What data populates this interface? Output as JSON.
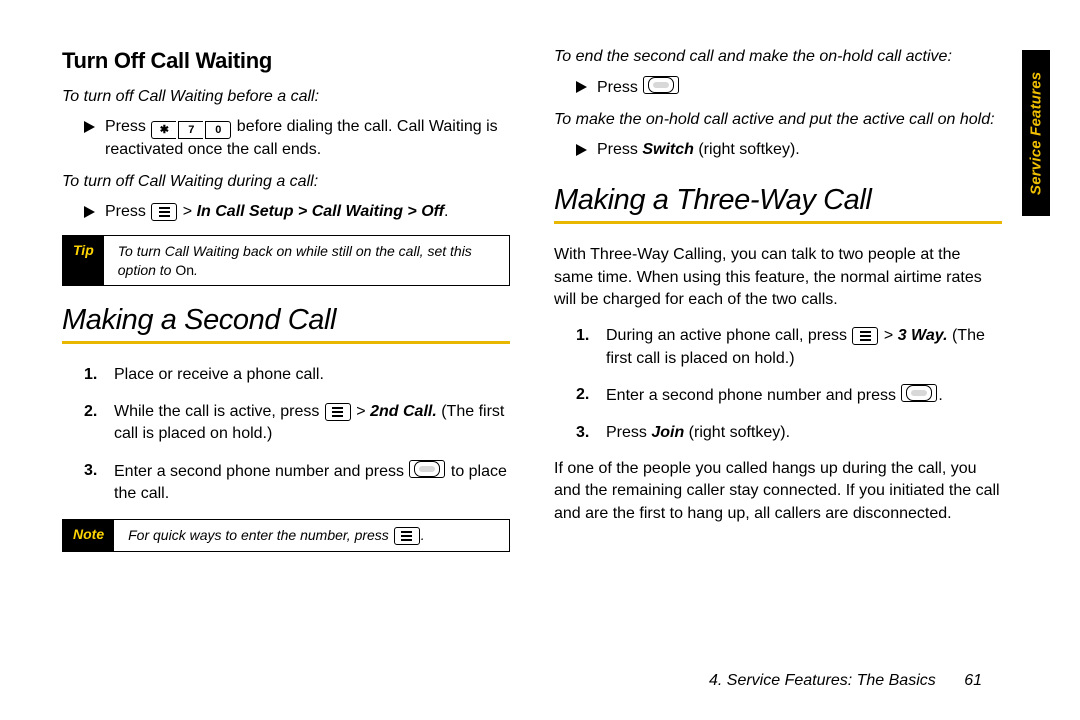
{
  "sidetab": "Service Features",
  "footer": {
    "title": "4. Service Features: The Basics",
    "page": "61"
  },
  "left": {
    "h3": "Turn Off Call Waiting",
    "lead1": "To turn off Call Waiting before a call:",
    "b1_a": "Press ",
    "b1_keys": [
      "✱",
      "7",
      "0"
    ],
    "b1_b": " before dialing the call. Call Waiting is reactivated once the call ends.",
    "lead2": "To turn off Call Waiting during a call:",
    "b2_a": "Press ",
    "b2_b": " > ",
    "b2_path": "In Call Setup > Call Waiting > Off",
    "b2_dot": ".",
    "tip_tag": "Tip",
    "tip_body_a": "To turn Call Waiting back on while still on the call, set this option to ",
    "tip_body_b": "On",
    "tip_body_c": ".",
    "h2": "Making a Second Call",
    "s1": "Place or receive a phone call.",
    "s2_a": "While the call is active, press ",
    "s2_b": " > ",
    "s2_cmd": "2nd Call.",
    "s2_c": " (The first call is placed on hold.)",
    "s3_a": "Enter a second phone number and press ",
    "s3_b": " to place the call.",
    "note_tag": "Note",
    "note_body": "For quick ways to enter the number, press ",
    "note_dot": "."
  },
  "right": {
    "lead1": "To end the second call and make the on-hold call active:",
    "b1_a": "Press ",
    "lead2": "To make the on-hold call active and put the active call on hold:",
    "b2_a": "Press ",
    "b2_cmd": "Switch",
    "b2_b": " (right softkey).",
    "h2": "Making a Three-Way Call",
    "para": "With Three-Way Calling, you can talk to two people at the same time. When using this feature, the normal airtime rates will be charged for each of the two calls.",
    "s1_a": "During an active phone call, press ",
    "s1_b": " > ",
    "s1_cmd": "3 Way.",
    "s1_c": " (The first call is placed on hold.)",
    "s2_a": "Enter a second phone number and press ",
    "s2_b": ".",
    "s3_a": "Press ",
    "s3_cmd": "Join",
    "s3_b": " (right softkey).",
    "para2": "If one of the people you called hangs up during the call, you and the remaining caller stay connected. If you initiated the call and are the first to hang up, all callers are disconnected."
  }
}
